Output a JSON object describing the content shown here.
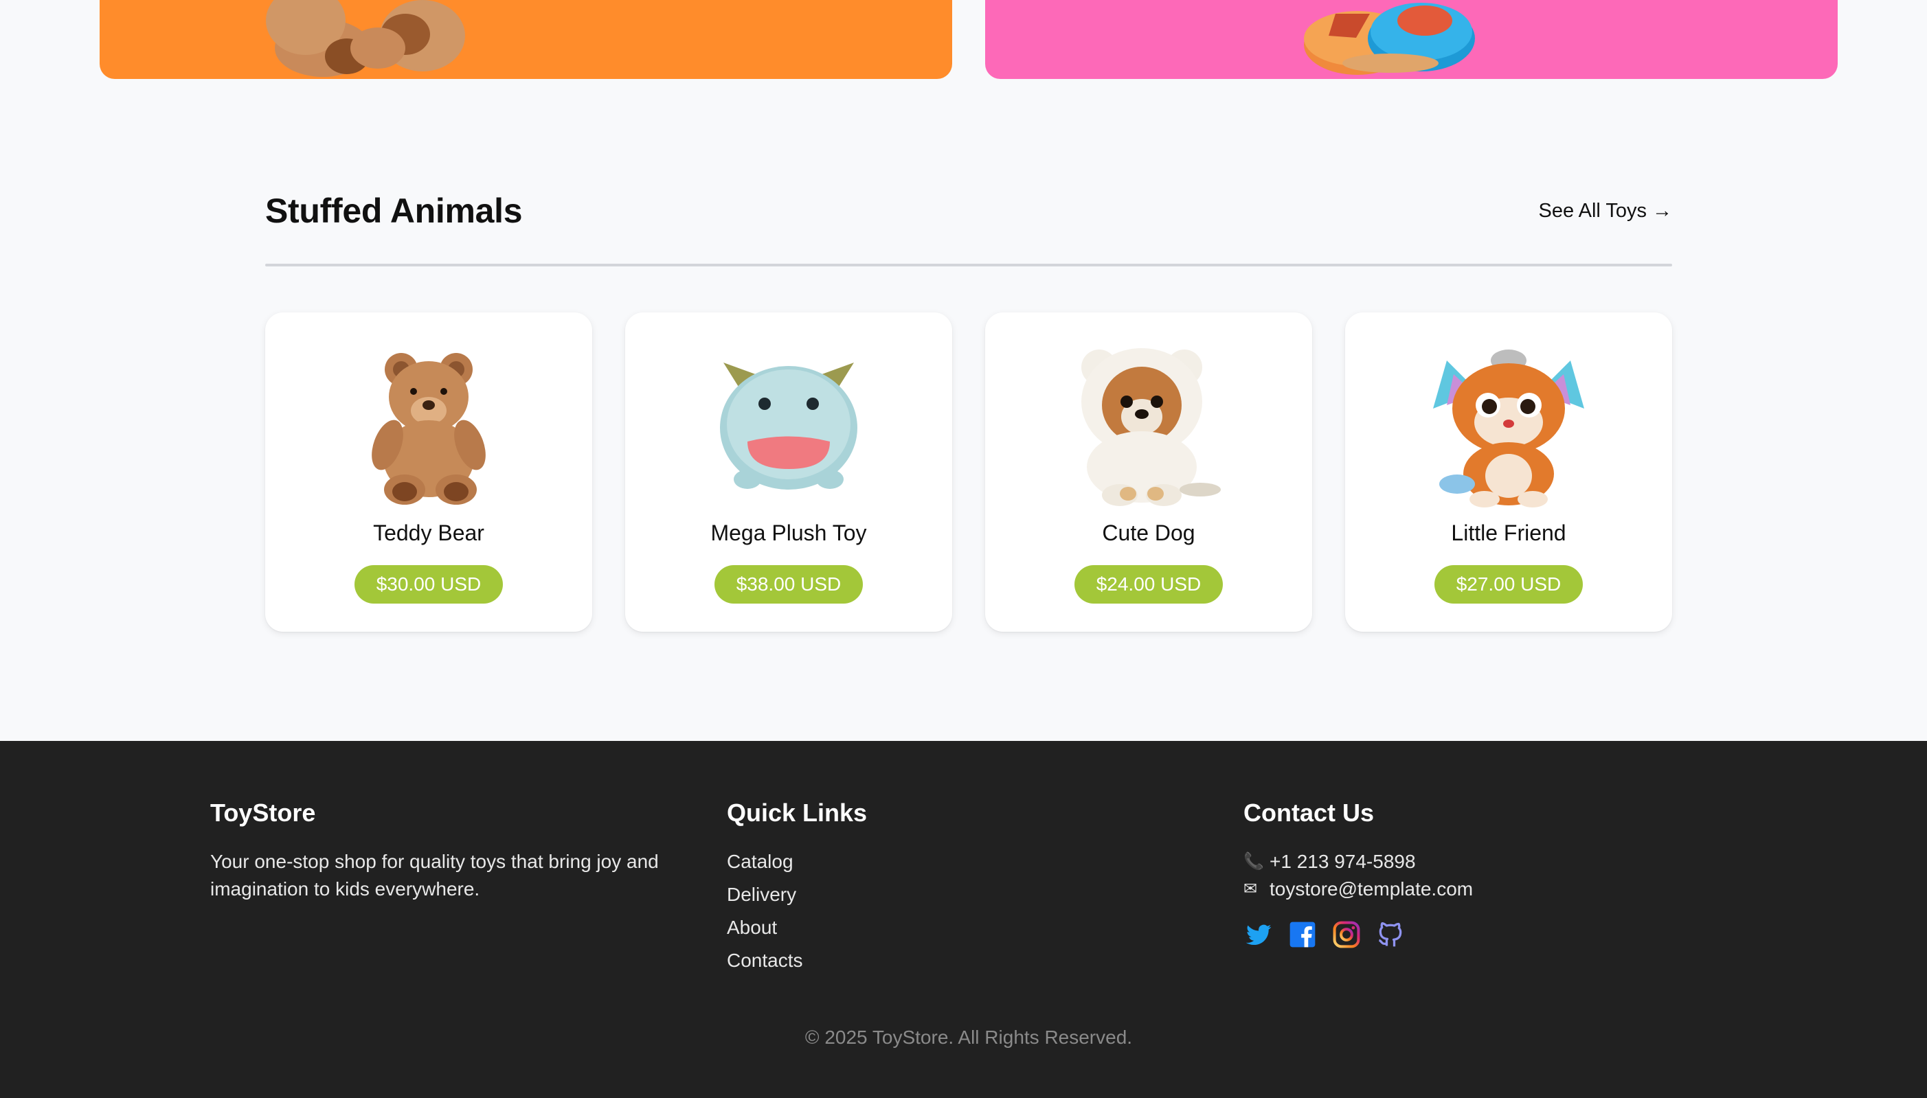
{
  "banners": [
    {
      "name": "orange-banner",
      "color": "#ff8c2b",
      "image": "teddy-bear-image"
    },
    {
      "name": "pink-banner",
      "color": "#fd69b8",
      "image": "shape-sorter-image"
    }
  ],
  "section": {
    "title": "Stuffed Animals",
    "see_all": "See All Toys",
    "see_all_icon": "arrow-right-icon"
  },
  "products": [
    {
      "name": "Teddy Bear",
      "price": "$30.00 USD",
      "image": "teddy-bear-image"
    },
    {
      "name": "Mega Plush Toy",
      "price": "$38.00 USD",
      "image": "plush-monster-image"
    },
    {
      "name": "Cute Dog",
      "price": "$24.00 USD",
      "image": "puppy-plush-image"
    },
    {
      "name": "Little Friend",
      "price": "$27.00 USD",
      "image": "fox-plush-image"
    }
  ],
  "colors": {
    "price_badge": "#a3c739",
    "footer_bg": "#212121",
    "page_bg": "#f8f9fb"
  },
  "footer": {
    "brand": {
      "title": "ToyStore",
      "description": "Your one-stop shop for quality toys that bring joy and imagination to kids everywhere."
    },
    "quick_links": {
      "title": "Quick Links",
      "items": [
        "Catalog",
        "Delivery",
        "About",
        "Contacts"
      ]
    },
    "contact": {
      "title": "Contact Us",
      "phone": "+1 213 974-5898",
      "email": "toystore@template.com",
      "phone_icon": "phone-icon",
      "email_icon": "envelope-icon",
      "social": [
        "twitter-icon",
        "facebook-icon",
        "instagram-icon",
        "github-icon"
      ]
    },
    "copyright": "© 2025 ToyStore. All Rights Reserved."
  }
}
